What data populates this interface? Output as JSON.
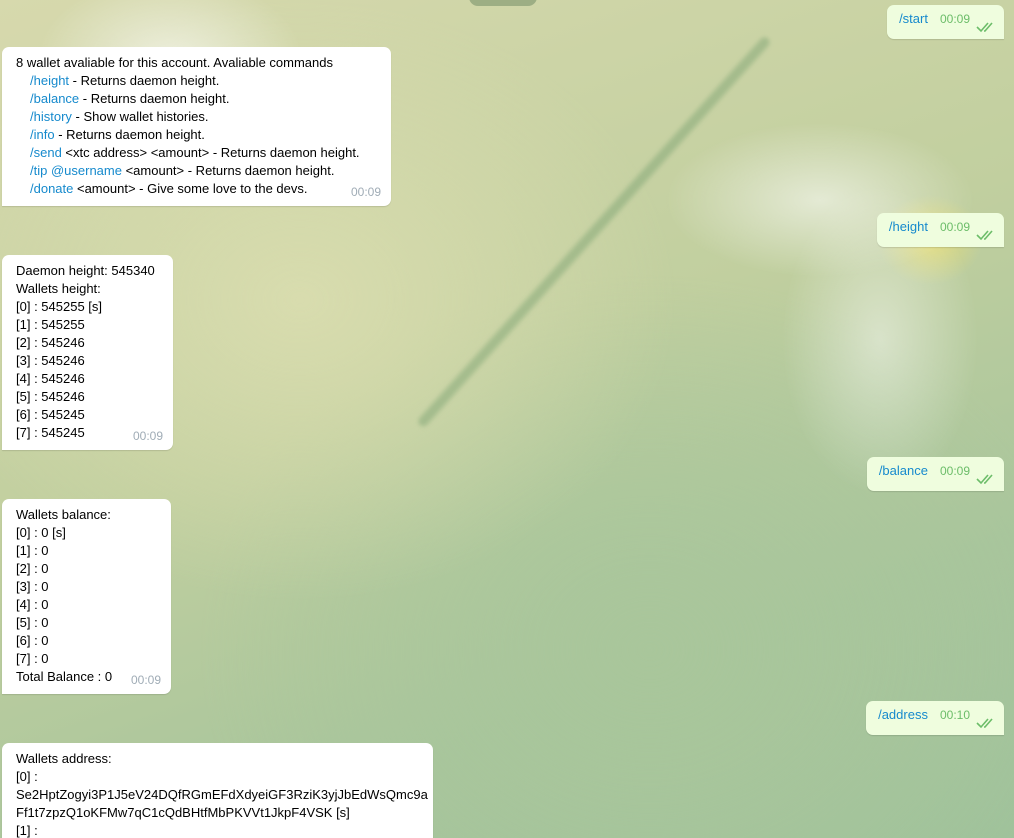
{
  "chat": {
    "messages": [
      {
        "id": "m1",
        "dir": "out",
        "text": "/start",
        "time": "00:09"
      },
      {
        "id": "m2",
        "dir": "in",
        "intro": "8 wallet avaliable for this account. Avaliable commands",
        "commands": [
          {
            "cmd": "/height",
            "desc": " - Returns daemon height."
          },
          {
            "cmd": "/balance",
            "desc": " - Returns daemon height."
          },
          {
            "cmd": "/history",
            "desc": "  - Show wallet histories."
          },
          {
            "cmd": "/info",
            "desc": " - Returns daemon height."
          },
          {
            "cmd": "/send",
            "desc": " <xtc address> <amount>  - Returns daemon height."
          },
          {
            "cmd": "/tip @username",
            "desc": " <amount>  - Returns daemon height."
          },
          {
            "cmd": "/donate",
            "desc": " <amount>  - Give some love to the devs."
          }
        ],
        "time": "00:09"
      },
      {
        "id": "m3",
        "dir": "out",
        "text": "/height",
        "time": "00:09"
      },
      {
        "id": "m4",
        "dir": "in",
        "lines": [
          "Daemon height: 545340",
          "Wallets height:",
          "[0] : 545255 [s]",
          "[1] : 545255",
          "[2] : 545246",
          "[3] : 545246",
          "[4] : 545246",
          "[5] : 545246",
          "[6] : 545245",
          "[7] : 545245"
        ],
        "time": "00:09"
      },
      {
        "id": "m5",
        "dir": "out",
        "text": "/balance",
        "time": "00:09"
      },
      {
        "id": "m6",
        "dir": "in",
        "lines": [
          "Wallets balance:",
          "[0] : 0 [s]",
          "[1] : 0",
          "[2] : 0",
          "[3] : 0",
          "[4] : 0",
          "[5] : 0",
          "[6] : 0",
          "[7] : 0",
          "Total Balance : 0"
        ],
        "time": "00:09"
      },
      {
        "id": "m7",
        "dir": "out",
        "text": "/address",
        "time": "00:10"
      },
      {
        "id": "m8",
        "dir": "in",
        "lines": [
          "Wallets address:",
          "[0] :",
          "Se2HptZogyi3P1J5eV24DQfRGmEFdXdyeiGF3RziK3yjJbEdWsQmc9a",
          "Ff1t7zpzQ1oKFMw7qC1cQdBHtfMbPKVVt1JkpF4VSK [s]",
          "[1] :"
        ]
      }
    ]
  },
  "colors": {
    "outgoing_bubble": "#effdde",
    "incoming_bubble": "#ffffff",
    "link": "#168acd",
    "out_time": "#6cbd69",
    "in_time": "#a0acb6"
  },
  "icons": {
    "read_receipt": "double-check-icon"
  }
}
